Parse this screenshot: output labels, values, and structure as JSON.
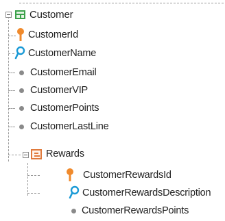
{
  "tree": {
    "root": {
      "label": "Customer",
      "icon": "transaction-table-icon"
    },
    "attributes": [
      {
        "label": "CustomerId",
        "icon": "primary-key-icon"
      },
      {
        "label": "CustomerName",
        "icon": "description-attribute-icon"
      },
      {
        "label": "CustomerEmail",
        "icon": "attribute-dot-icon"
      },
      {
        "label": "CustomerVIP",
        "icon": "attribute-dot-icon"
      },
      {
        "label": "CustomerPoints",
        "icon": "attribute-dot-icon"
      },
      {
        "label": "CustomerLastLine",
        "icon": "attribute-dot-icon"
      }
    ],
    "level": {
      "label": "Rewards",
      "icon": "subtransaction-level-icon",
      "attributes": [
        {
          "label": "CustomerRewardsId",
          "icon": "primary-key-icon"
        },
        {
          "label": "CustomerRewardsDescription",
          "icon": "description-attribute-icon"
        },
        {
          "label": "CustomerRewardsPoints",
          "icon": "attribute-dot-icon"
        }
      ]
    }
  },
  "colors": {
    "key_icon": "#f08a2c",
    "description_icon": "#1a9ad6",
    "table_icon": "#3aa14a",
    "level_icon": "#e07a3c",
    "dot_icon": "#8a8a8a",
    "guide_lines": "#9a9a9a"
  }
}
